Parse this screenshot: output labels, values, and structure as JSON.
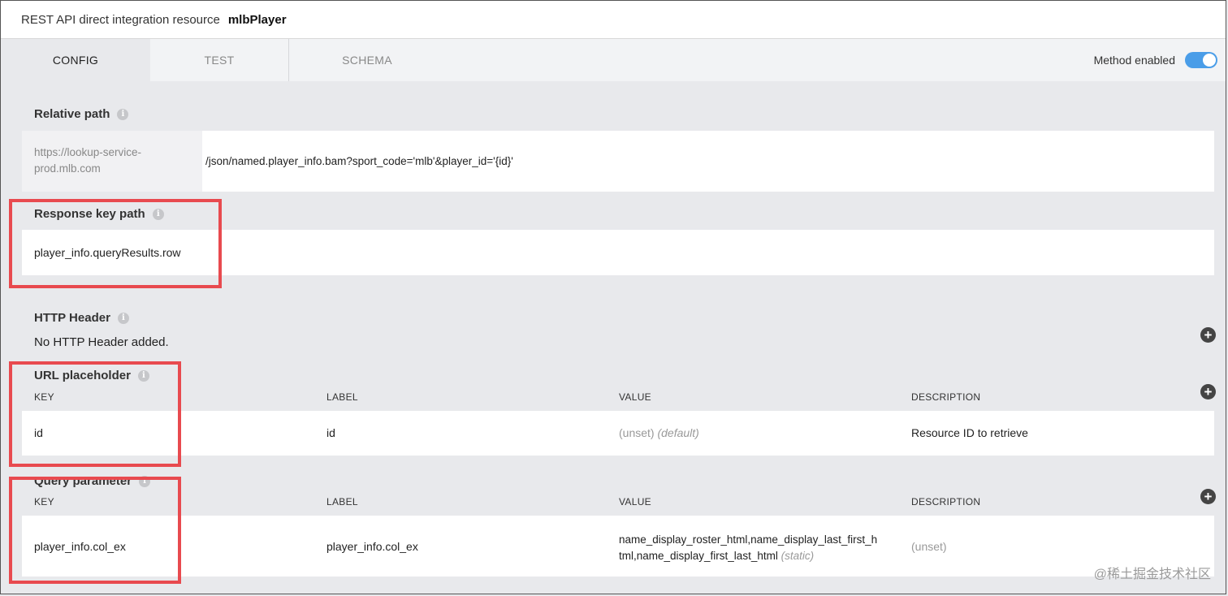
{
  "window": {
    "title_prefix": "REST API direct integration resource",
    "resource_name": "mlbPlayer"
  },
  "tabs": [
    {
      "label": "CONFIG",
      "active": true
    },
    {
      "label": "TEST",
      "active": false
    },
    {
      "label": "SCHEMA",
      "active": false
    }
  ],
  "method": {
    "label": "Method enabled",
    "enabled": true
  },
  "relative_path": {
    "label": "Relative path",
    "host": "https://lookup-service-prod.mlb.com",
    "path": "/json/named.player_info.bam?sport_code='mlb'&player_id='{id}'"
  },
  "response_key_path": {
    "label": "Response key path",
    "value": "player_info.queryResults.row"
  },
  "http_header": {
    "label": "HTTP Header",
    "empty_text": "No HTTP Header added."
  },
  "url_placeholder": {
    "label": "URL placeholder",
    "columns": [
      "KEY",
      "LABEL",
      "VALUE",
      "DESCRIPTION"
    ],
    "rows": [
      {
        "key": "id",
        "label": "id",
        "value": "(unset)",
        "value_suffix": "(default)",
        "description": "Resource ID to retrieve"
      }
    ]
  },
  "query_parameter": {
    "label": "Query parameter",
    "columns": [
      "KEY",
      "LABEL",
      "VALUE",
      "DESCRIPTION"
    ],
    "rows": [
      {
        "key": "player_info.col_ex",
        "label": "player_info.col_ex",
        "value_line1": "name_display_roster_html,name_display_last_first_h",
        "value_line2": "tml,name_display_first_last_html",
        "value_suffix": "(static)",
        "description": "(unset)"
      }
    ]
  },
  "watermark": "@稀土掘金技术社区",
  "colors": {
    "accent": "#4a9de8",
    "highlight": "#e84a4f"
  }
}
